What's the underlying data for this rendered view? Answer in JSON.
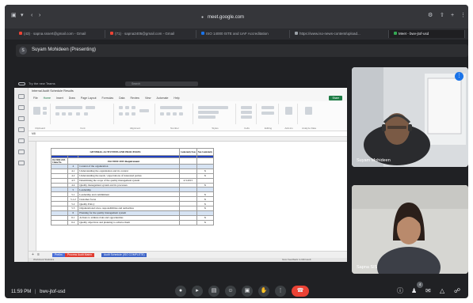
{
  "browser": {
    "url": "meet.google.com",
    "tabs": [
      {
        "label": "(43) · sapna.sssert@gmail.com - Gmail",
        "color": "#ea4335"
      },
      {
        "label": "(71) · sapna2405@gmail.com - Gmail",
        "color": "#ea4335"
      },
      {
        "label": "ISO 14000 ISTE and UAF Accreditation",
        "color": "#1a73e8"
      },
      {
        "label": "https://www.iso-news-content/upload...",
        "color": "#9aa0a6"
      },
      {
        "label": "Meet - bwv-jtof-usd",
        "color": "#34a853"
      }
    ]
  },
  "presenter": {
    "initial": "S",
    "name": "Suyam Mohideen (Presenting)"
  },
  "excel": {
    "window_title": "Try the new Teams",
    "search_placeholder": "Search",
    "doc_name": "Internal Audit Schedule Results",
    "menu": [
      "File",
      "Home",
      "Insert",
      "Draw",
      "Page Layout",
      "Formulas",
      "Data",
      "Review",
      "View",
      "Automate",
      "Help"
    ],
    "share": "Share",
    "groups": [
      "Clipboard",
      "Font",
      "Alignment",
      "Number",
      "Styles",
      "Cells",
      "Editing",
      "Add-ins",
      "Analyze Data"
    ],
    "name_box": "M8",
    "sheet_title": "GENERAL ACTIVITIES AND PROCESSES",
    "col_conformity": "Conformity Note",
    "col_nonconformity": "Non Conformity",
    "iso_header": "ISO 9001:2015 Clause No.",
    "requirements_header": "ISO 9001:2015 Requirement",
    "rows": [
      {
        "no": "4",
        "text": "Context of the organization",
        "a": "",
        "b": "",
        "sec": true
      },
      {
        "no": "4.1",
        "text": "Understanding the organization and its context",
        "a": "",
        "b": "X",
        "sec": false
      },
      {
        "no": "4.2",
        "text": "Understanding the needs / expectations of interested parties",
        "a": "",
        "b": "X",
        "sec": false
      },
      {
        "no": "4.3",
        "text": "Determining the scope of the quality management system",
        "a": "4.3.2015",
        "b": "",
        "sec": false
      },
      {
        "no": "4.4",
        "text": "Quality management system and its processes",
        "a": "",
        "b": "X",
        "sec": false
      },
      {
        "no": "5",
        "text": "Leadership",
        "a": "",
        "b": "",
        "sec": true
      },
      {
        "no": "5.1",
        "text": "Leadership and commitment",
        "a": "",
        "b": "X",
        "sec": false
      },
      {
        "no": "5.1.2",
        "text": "Customer focus",
        "a": "",
        "b": "X",
        "sec": false
      },
      {
        "no": "5.2",
        "text": "Quality Policy",
        "a": "",
        "b": "X",
        "sec": false
      },
      {
        "no": "5.3",
        "text": "Organizational roles, responsibilities and authorities",
        "a": "",
        "b": "X",
        "sec": false
      },
      {
        "no": "6",
        "text": "Planning for the quality management system",
        "a": "",
        "b": "",
        "sec": true
      },
      {
        "no": "6.1",
        "text": "Actions to address risks and opportunities",
        "a": "",
        "b": "X",
        "sec": false
      },
      {
        "no": "6.2",
        "text": "Quality objectives and planning to achieve them",
        "a": "",
        "b": "X",
        "sec": false
      }
    ],
    "sheet_tabs": [
      {
        "label": "Prelim",
        "color": "#4a6fd8"
      },
      {
        "label": "Process Audit Matrix",
        "color": "#e03c31"
      },
      {
        "label": "Audit Schedule (ISO COMPLETE)",
        "color": "#3d64c8"
      }
    ],
    "status_left": "Workbook Statistics",
    "status_right": "Give Feedback to Microsoft"
  },
  "participants": [
    {
      "name": "Suyam Mohideen"
    },
    {
      "name": "Sapna SIS"
    }
  ],
  "meeting": {
    "time": "11:59 PM",
    "separator": "|",
    "code": "bwv-jtof-usd",
    "people_count": "4"
  }
}
